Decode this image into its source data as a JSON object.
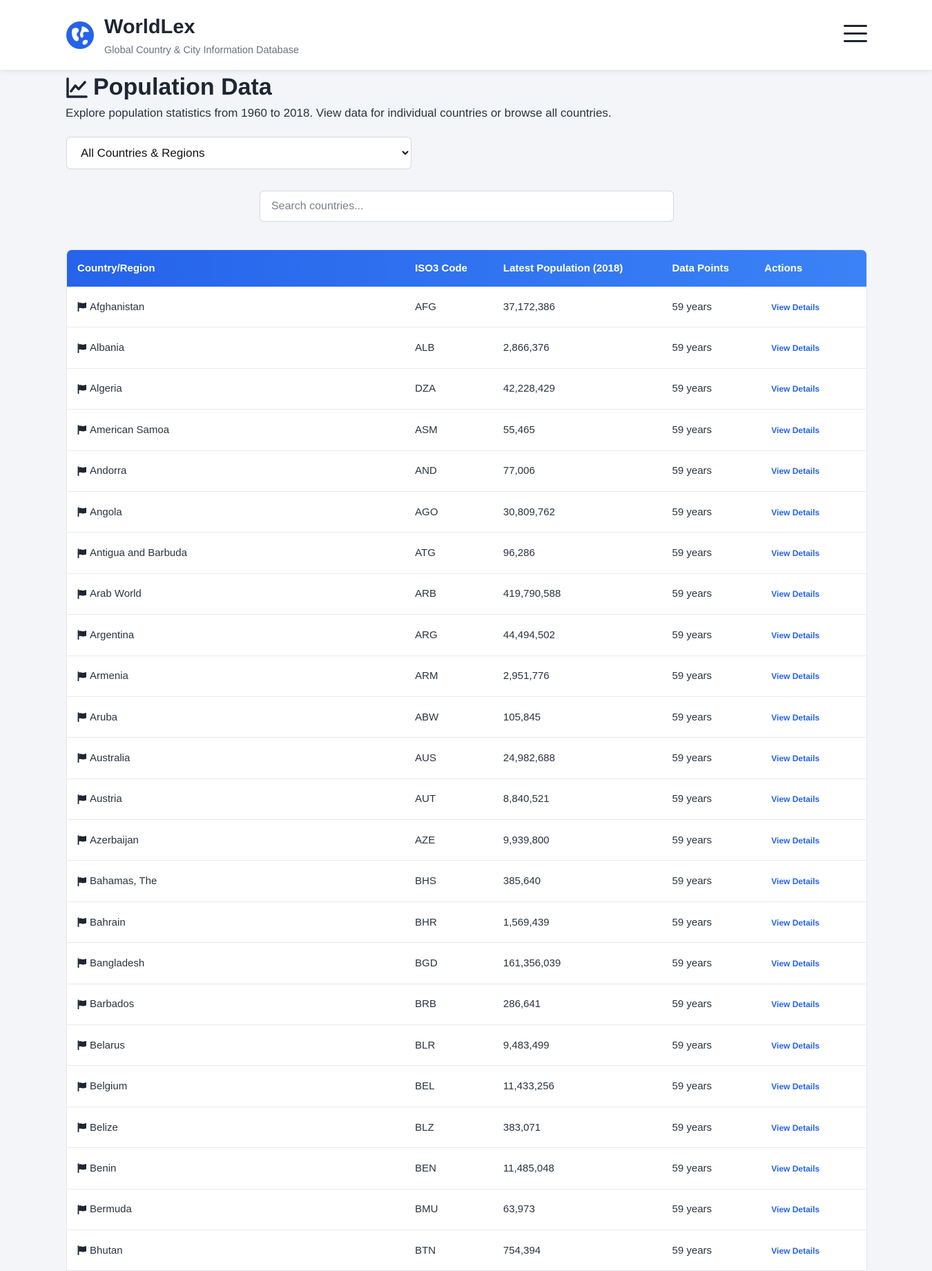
{
  "header": {
    "app_title": "WorldLex",
    "app_subtitle": "Global Country & City Information Database",
    "logo_icon": "globe-icon",
    "menu_icon": "hamburger-menu-icon"
  },
  "page": {
    "title": "Population Data",
    "title_icon": "line-chart-icon",
    "description": "Explore population statistics from 1960 to 2018. View data for individual countries or browse all countries."
  },
  "filter": {
    "selected": "All Countries & Regions",
    "options": [
      "All Countries & Regions"
    ]
  },
  "search": {
    "placeholder": "Search countries...",
    "value": ""
  },
  "colors": {
    "accent": "#2563eb",
    "header_gradient_end": "#3b82f6",
    "text_dark": "#1e2533"
  },
  "table": {
    "columns": [
      "Country/Region",
      "ISO3 Code",
      "Latest Population (2018)",
      "Data Points",
      "Actions"
    ],
    "action_label": "View Details",
    "row_icon": "flag-icon",
    "rows": [
      {
        "name": "Afghanistan",
        "iso": "AFG",
        "population": "37,172,386",
        "points": "59 years"
      },
      {
        "name": "Albania",
        "iso": "ALB",
        "population": "2,866,376",
        "points": "59 years"
      },
      {
        "name": "Algeria",
        "iso": "DZA",
        "population": "42,228,429",
        "points": "59 years"
      },
      {
        "name": "American Samoa",
        "iso": "ASM",
        "population": "55,465",
        "points": "59 years"
      },
      {
        "name": "Andorra",
        "iso": "AND",
        "population": "77,006",
        "points": "59 years"
      },
      {
        "name": "Angola",
        "iso": "AGO",
        "population": "30,809,762",
        "points": "59 years"
      },
      {
        "name": "Antigua and Barbuda",
        "iso": "ATG",
        "population": "96,286",
        "points": "59 years"
      },
      {
        "name": "Arab World",
        "iso": "ARB",
        "population": "419,790,588",
        "points": "59 years"
      },
      {
        "name": "Argentina",
        "iso": "ARG",
        "population": "44,494,502",
        "points": "59 years"
      },
      {
        "name": "Armenia",
        "iso": "ARM",
        "population": "2,951,776",
        "points": "59 years"
      },
      {
        "name": "Aruba",
        "iso": "ABW",
        "population": "105,845",
        "points": "59 years"
      },
      {
        "name": "Australia",
        "iso": "AUS",
        "population": "24,982,688",
        "points": "59 years"
      },
      {
        "name": "Austria",
        "iso": "AUT",
        "population": "8,840,521",
        "points": "59 years"
      },
      {
        "name": "Azerbaijan",
        "iso": "AZE",
        "population": "9,939,800",
        "points": "59 years"
      },
      {
        "name": "Bahamas, The",
        "iso": "BHS",
        "population": "385,640",
        "points": "59 years"
      },
      {
        "name": "Bahrain",
        "iso": "BHR",
        "population": "1,569,439",
        "points": "59 years"
      },
      {
        "name": "Bangladesh",
        "iso": "BGD",
        "population": "161,356,039",
        "points": "59 years"
      },
      {
        "name": "Barbados",
        "iso": "BRB",
        "population": "286,641",
        "points": "59 years"
      },
      {
        "name": "Belarus",
        "iso": "BLR",
        "population": "9,483,499",
        "points": "59 years"
      },
      {
        "name": "Belgium",
        "iso": "BEL",
        "population": "11,433,256",
        "points": "59 years"
      },
      {
        "name": "Belize",
        "iso": "BLZ",
        "population": "383,071",
        "points": "59 years"
      },
      {
        "name": "Benin",
        "iso": "BEN",
        "population": "11,485,048",
        "points": "59 years"
      },
      {
        "name": "Bermuda",
        "iso": "BMU",
        "population": "63,973",
        "points": "59 years"
      },
      {
        "name": "Bhutan",
        "iso": "BTN",
        "population": "754,394",
        "points": "59 years"
      }
    ]
  }
}
